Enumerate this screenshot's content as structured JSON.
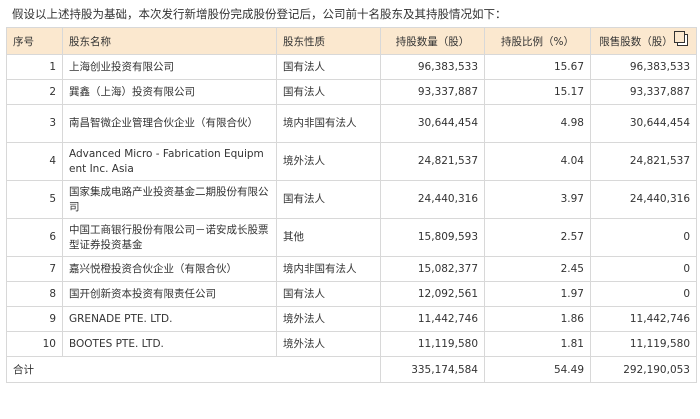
{
  "intro": "假设以上述持股为基础，本次发行新增股份完成股份登记后，公司前十名股东及其持股情况如下：",
  "table": {
    "headers": [
      "序号",
      "股东名称",
      "股东性质",
      "持股数量（股）",
      "持股比例（%）",
      "限售股数（股）"
    ],
    "rows": [
      {
        "idx": "1",
        "name": "上海创业投资有限公司",
        "nature": "国有法人",
        "shares": "96,383,533",
        "ratio": "15.67",
        "restricted": "96,383,533"
      },
      {
        "idx": "2",
        "name": "巽鑫（上海）投资有限公司",
        "nature": "国有法人",
        "shares": "93,337,887",
        "ratio": "15.17",
        "restricted": "93,337,887"
      },
      {
        "idx": "3",
        "name": "南昌智微企业管理合伙企业（有限合伙）",
        "nature": "境内非国有法人",
        "shares": "30,644,454",
        "ratio": "4.98",
        "restricted": "30,644,454"
      },
      {
        "idx": "4",
        "name": "Advanced Micro - Fabrication Equipment Inc. Asia",
        "nature": "境外法人",
        "shares": "24,821,537",
        "ratio": "4.04",
        "restricted": "24,821,537"
      },
      {
        "idx": "5",
        "name": "国家集成电路产业投资基金二期股份有限公司",
        "nature": "国有法人",
        "shares": "24,440,316",
        "ratio": "3.97",
        "restricted": "24,440,316"
      },
      {
        "idx": "6",
        "name": "中国工商银行股份有限公司－诺安成长股票型证券投资基金",
        "nature": "其他",
        "shares": "15,809,593",
        "ratio": "2.57",
        "restricted": "0"
      },
      {
        "idx": "7",
        "name": "嘉兴悦橙投资合伙企业（有限合伙）",
        "nature": "境内非国有法人",
        "shares": "15,082,377",
        "ratio": "2.45",
        "restricted": "0"
      },
      {
        "idx": "8",
        "name": "国开创新资本投资有限责任公司",
        "nature": "国有法人",
        "shares": "12,092,561",
        "ratio": "1.97",
        "restricted": "0"
      },
      {
        "idx": "9",
        "name": "GRENADE PTE. LTD.",
        "nature": "境外法人",
        "shares": "11,442,746",
        "ratio": "1.86",
        "restricted": "11,442,746"
      },
      {
        "idx": "10",
        "name": "BOOTES PTE. LTD.",
        "nature": "境外法人",
        "shares": "11,119,580",
        "ratio": "1.81",
        "restricted": "11,119,580"
      }
    ],
    "total": {
      "label": "合计",
      "shares": "335,174,584",
      "ratio": "54.49",
      "restricted": "292,190,053"
    }
  },
  "icons": {
    "copy": "copy-icon"
  },
  "colors": {
    "header_bg": "#fbe8cf",
    "border": "#d8d8d8"
  }
}
